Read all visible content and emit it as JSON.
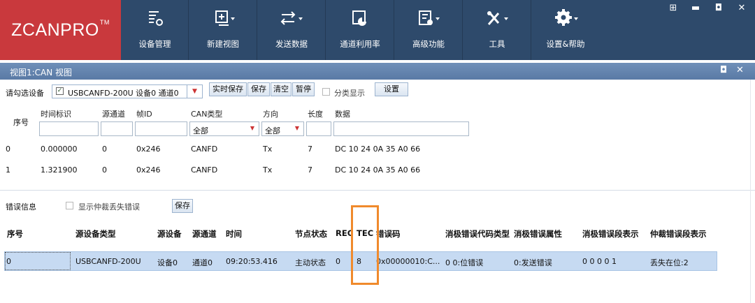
{
  "app": {
    "logo": "ZCANPRO",
    "logo_tm": "TM"
  },
  "toolbar": [
    {
      "label": "设备管理",
      "icon": "device-manage-icon"
    },
    {
      "label": "新建视图",
      "icon": "new-view-icon"
    },
    {
      "label": "发送数据",
      "icon": "send-data-icon"
    },
    {
      "label": "通道利用率",
      "icon": "channel-usage-icon"
    },
    {
      "label": "高级功能",
      "icon": "advanced-icon"
    },
    {
      "label": "工具",
      "icon": "tools-icon"
    },
    {
      "label": "设置&帮助",
      "icon": "settings-icon"
    }
  ],
  "window_controls": {
    "grid": "⊞",
    "minimize": "▬",
    "maximize": "◘",
    "close": "✕"
  },
  "view": {
    "title": "视图1:CAN 视图",
    "restore": "◘",
    "close": "✕"
  },
  "device": {
    "label": "请勾选设备",
    "selected": "USBCANFD-200U 设备0 通道0",
    "buttons": [
      "实时保存",
      "保存",
      "清空",
      "暂停"
    ],
    "classify_label": "分类显示",
    "settings": "设置"
  },
  "filter": {
    "seq": "序号",
    "time": "时间标识",
    "src_channel": "源通道",
    "frame_id": "帧ID",
    "can_type": "CAN类型",
    "can_type_value": "全部",
    "direction": "方向",
    "direction_value": "全部",
    "length": "长度",
    "data": "数据"
  },
  "frames": [
    {
      "seq": "0",
      "time": "0.000000",
      "ch": "0",
      "id": "0x246",
      "type": "CANFD",
      "dir": "Tx",
      "len": "7",
      "data": "DC 10 24 0A 35 A0 66"
    },
    {
      "seq": "1",
      "time": "1.321900",
      "ch": "0",
      "id": "0x246",
      "type": "CANFD",
      "dir": "Tx",
      "len": "7",
      "data": "DC 10 24 0A 35 A0 66"
    }
  ],
  "error": {
    "label": "错误信息",
    "show_arb_label": "显示仲裁丢失错误",
    "save": "保存",
    "columns": [
      "序号",
      "源设备类型",
      "源设备",
      "源通道",
      "时间",
      "节点状态",
      "REC",
      "TEC",
      "错误码",
      "消极错误代码类型",
      "消极错误属性",
      "消极错误段表示",
      "仲裁错误段表示"
    ],
    "rows": [
      [
        "0",
        "USBCANFD-200U",
        "设备0",
        "通道0",
        "09:20:53.416",
        "主动状态",
        "0",
        "8",
        "0x00000010:C...",
        "0 0:位错误",
        "0:发送错误",
        "0 0 0 0 1",
        "丢失在位:2"
      ]
    ]
  },
  "colors": {
    "toolbar_bg": "#2e4a6b",
    "logo_bg": "#c9393d",
    "highlight": "#f08a2c",
    "selected_row": "#c6daf2"
  }
}
